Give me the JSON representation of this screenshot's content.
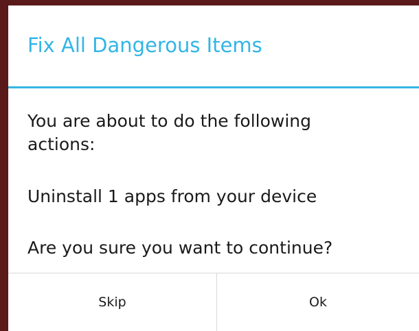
{
  "dialog": {
    "title": "Fix All Dangerous Items",
    "message_line1": "You are about to do the following",
    "message_line2": "actions:",
    "action_item": "Uninstall 1 apps from your device",
    "confirm_question": "Are you sure you want to continue?",
    "buttons": {
      "skip_label": "Skip",
      "ok_label": "Ok"
    }
  },
  "colors": {
    "accent": "#33b5e5",
    "backdrop": "#5a1a1a"
  }
}
